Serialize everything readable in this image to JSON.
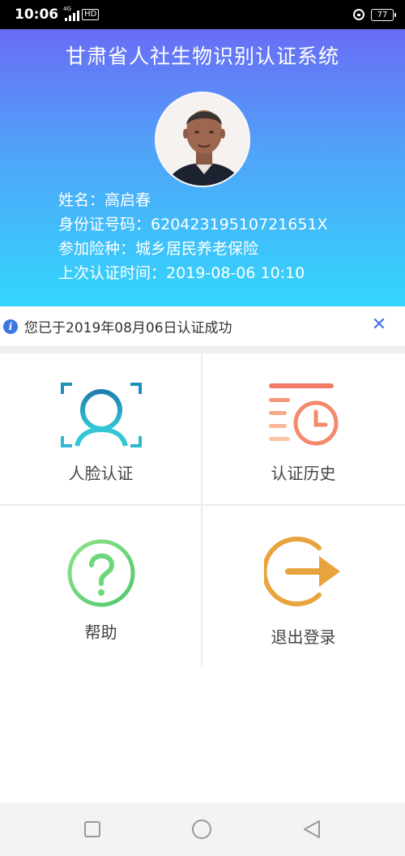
{
  "status_bar": {
    "time": "10:06",
    "network": "4G",
    "hd": "HD",
    "battery": "77"
  },
  "header": {
    "title": "甘肃省人社生物识别认证系统",
    "info": [
      {
        "label": "姓名：",
        "value": "高启春"
      },
      {
        "label": "身份证号码：",
        "value": "62042319510721651X"
      },
      {
        "label": "参加险种：",
        "value": "城乡居民养老保险"
      },
      {
        "label": "上次认证时间：",
        "value": "2019-08-06  10:10"
      }
    ]
  },
  "notice": {
    "text": "您已于2019年08月06日认证成功",
    "icon": "info-icon",
    "close_icon": "close-icon"
  },
  "menu": {
    "face_auth": {
      "label": "人脸认证",
      "icon": "face-scan-icon",
      "color": "#1f8fb8"
    },
    "history": {
      "label": "认证历史",
      "icon": "history-clock-icon",
      "color": "#f07a63"
    },
    "help": {
      "label": "帮助",
      "icon": "help-icon",
      "color": "#6cd67a"
    },
    "logout": {
      "label": "退出登录",
      "icon": "logout-icon",
      "color": "#e8a43c"
    }
  },
  "navbar": {
    "items": [
      "recent-apps-icon",
      "home-icon",
      "back-icon"
    ]
  }
}
